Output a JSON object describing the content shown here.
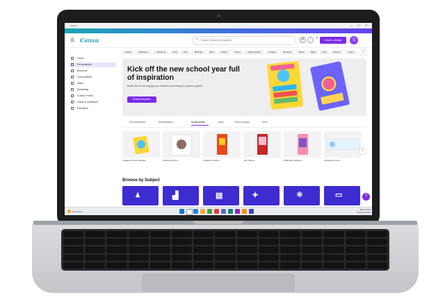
{
  "window": {
    "title": "Canva",
    "controls": [
      "—",
      "☐",
      "✕"
    ]
  },
  "app": {
    "logo": "Canva",
    "accent": "#7d2ae8"
  },
  "header": {
    "search_placeholder": "Search millions of templates",
    "create_label": "Create a design",
    "avatar_initial": "S",
    "icons": [
      "settings-icon",
      "notifications-icon",
      "help-icon"
    ]
  },
  "sidebar": {
    "items": [
      {
        "label": "Home"
      },
      {
        "label": "Personalised"
      },
      {
        "label": "Business"
      },
      {
        "label": "Social Media"
      },
      {
        "label": "Video"
      },
      {
        "label": "Marketing"
      },
      {
        "label": "Custom Prints"
      },
      {
        "label": "Cards & Invitations"
      },
      {
        "label": "Education"
      }
    ]
  },
  "chips": [
    "Diwali",
    "Halloween",
    "Christmas",
    "Food",
    "Fall",
    "Birthday",
    "Blue",
    "Instant",
    "Green",
    "Happy Diwali",
    "Collage",
    "Business",
    "Music",
    "Black",
    "Pink",
    "Science",
    "Travel",
    "Bi"
  ],
  "hero": {
    "title": "Kick off the new school year full of inspiration",
    "subtitle": "Break the ice and engage your students by creating fun posters together",
    "button": "Browse templates"
  },
  "tabs": [
    "Recommended",
    "Presentations",
    "Social media",
    "Video",
    "Print products",
    "More"
  ],
  "active_tab_index": 2,
  "templates": [
    {
      "label": "Instagram Posts (Square)"
    },
    {
      "label": "Facebook Posts"
    },
    {
      "label": "Instagram Stories"
    },
    {
      "label": "Your Stories"
    },
    {
      "label": "WhatsApp Statuses"
    },
    {
      "label": "Facebook Covers"
    }
  ],
  "browse": {
    "title": "Browse by Subject"
  },
  "taskbar": {
    "weather_temp": "29°C",
    "weather_desc": "Haze",
    "tray_lang": "ENG",
    "tray_region": "IN",
    "time": "19:48",
    "date": "24-10-2023"
  }
}
